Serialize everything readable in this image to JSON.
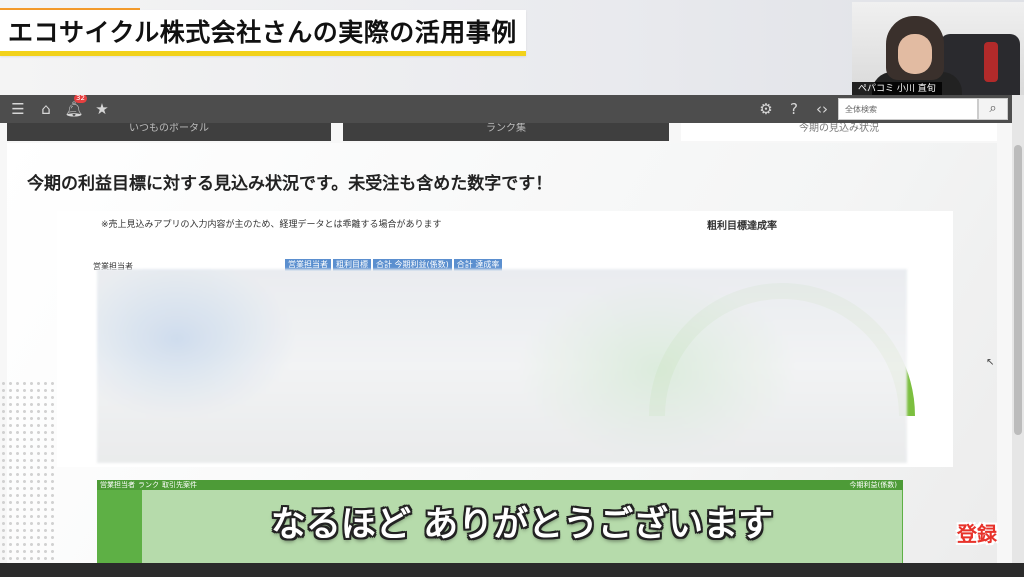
{
  "video": {
    "title": "エコサイクル株式会社さんの実際の活用事例",
    "subtitle": "なるほど ありがとうございます",
    "subscribe_label": "登録",
    "webcam_name": "ぺパコミ 小川 直旬"
  },
  "toolbar": {
    "menu_icon": "menu-icon",
    "home_icon": "home-icon",
    "bell_icon": "bell-icon",
    "notification_count": "32",
    "star_icon": "star-icon",
    "gear_icon": "gear-icon",
    "help_icon": "help-icon",
    "code_icon": "code-icon",
    "search_placeholder": "全体検索",
    "search_icon": "search-icon"
  },
  "tabs": [
    {
      "label": "いつものポータル",
      "active": false
    },
    {
      "label": "ランク集",
      "active": false
    },
    {
      "label": "今期の見込み状況",
      "active": true
    }
  ],
  "content": {
    "heading": "今期の利益目標に対する見込み状況です。未受注も含めた数字です！",
    "note": "※売上見込みアプリの入力内容が主のため、経理データとは乖離する場合があります",
    "sales_rep_label": "営業担当者",
    "table_headers": [
      "営業担当者",
      "粗利目標",
      "合計 今期利益(係数)",
      "合計 達成率"
    ],
    "gauge_title": "粗利目標達成率",
    "bottom_table_headers": [
      "営業担当者",
      "ランク",
      "取引先案件"
    ],
    "bottom_table_right_header": "今期利益(係数)"
  },
  "colors": {
    "title_underline": "#f2d21b",
    "toolbar_bg": "#4d4d4d",
    "gauge_green": "#7cbf3f",
    "table_header_blue": "#5b8fcf",
    "bottom_table_green": "#5eb045"
  }
}
